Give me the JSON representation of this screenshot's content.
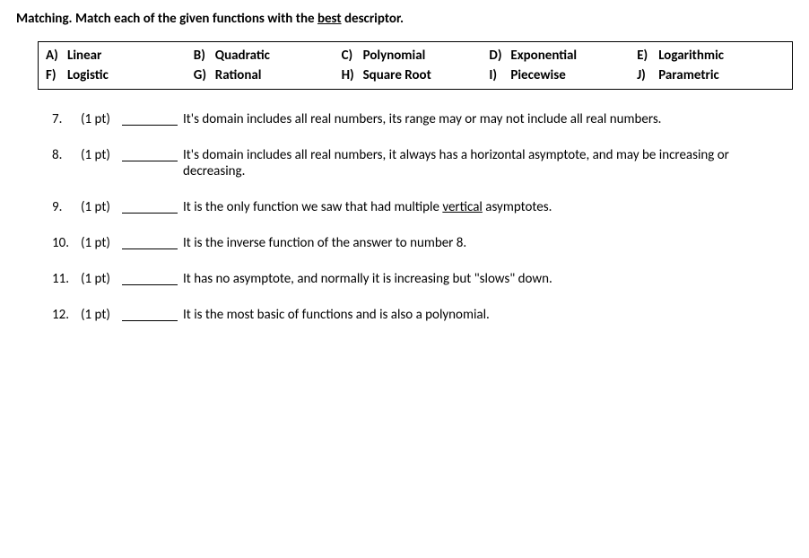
{
  "instructions": {
    "prefix": "Matching. Match each of the given functions with the ",
    "underlined": "best",
    "suffix": " descriptor."
  },
  "options": {
    "row1": [
      {
        "letter": "A)",
        "label": "Linear"
      },
      {
        "letter": "B)",
        "label": "Quadratic"
      },
      {
        "letter": "C)",
        "label": "Polynomial"
      },
      {
        "letter": "D)",
        "label": "Exponential"
      },
      {
        "letter": "E)",
        "label": "Logarithmic"
      }
    ],
    "row2": [
      {
        "letter": "F)",
        "label": "Logistic"
      },
      {
        "letter": "G)",
        "label": "Rational"
      },
      {
        "letter": "H)",
        "label": "Square Root"
      },
      {
        "letter": "I)",
        "label": "Piecewise"
      },
      {
        "letter": "J)",
        "label": "Parametric"
      }
    ]
  },
  "questions": [
    {
      "number": "7.",
      "points": "(1 pt)",
      "text": "It's domain includes all real numbers, its range may or may not include all real numbers."
    },
    {
      "number": "8.",
      "points": "(1 pt)",
      "text": "It's domain includes all real numbers, it always has a horizontal asymptote, and may be increasing or decreasing."
    },
    {
      "number": "9.",
      "points": "(1 pt)",
      "text_pre": "It is the only function we saw that had multiple ",
      "text_underlined": "vertical",
      "text_post": " asymptotes."
    },
    {
      "number": "10.",
      "points": "(1 pt)",
      "text": "It is the inverse function of the answer to number 8."
    },
    {
      "number": "11.",
      "points": "(1 pt)",
      "text": "It has no asymptote, and normally it is increasing but \"slows\" down."
    },
    {
      "number": "12.",
      "points": "(1 pt)",
      "text": "It is the most basic of functions and is also a polynomial."
    }
  ]
}
